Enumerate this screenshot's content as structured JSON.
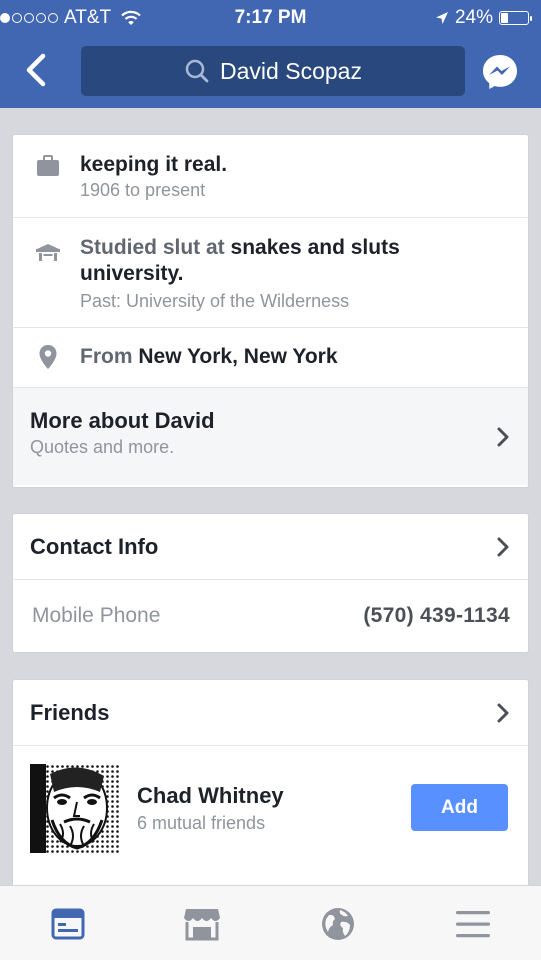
{
  "status_bar": {
    "carrier": "AT&T",
    "time": "7:17 PM",
    "battery": "24%",
    "signal_bars_filled": 1,
    "signal_bars_total": 5,
    "battery_level": 0.24
  },
  "header": {
    "search_text": "David Scopaz",
    "back_icon": "chevron-left-icon",
    "messenger_icon": "messenger-icon",
    "brand_color": "#4267b2"
  },
  "about": {
    "work": {
      "title": "keeping it real.",
      "subtitle": "1906 to present",
      "icon": "briefcase-icon"
    },
    "education": {
      "prefix": "Studied slut at ",
      "school": "snakes and sluts university.",
      "subtitle": "Past: University of the Wilderness",
      "icon": "school-icon"
    },
    "hometown": {
      "prefix": "From ",
      "place": "New York, New York",
      "icon": "location-pin-icon"
    },
    "more": {
      "title": "More about David",
      "subtitle": "Quotes and more."
    }
  },
  "contact_info": {
    "title": "Contact Info",
    "rows": [
      {
        "label": "Mobile Phone",
        "value": "(570) 439-1134"
      }
    ]
  },
  "friends": {
    "title": "Friends",
    "items": [
      {
        "name": "Chad Whitney",
        "mutual": "6 mutual friends",
        "action": "Add"
      }
    ]
  },
  "tab_bar": {
    "tabs": [
      {
        "icon": "news-feed-icon",
        "active": true
      },
      {
        "icon": "marketplace-icon",
        "active": false
      },
      {
        "icon": "globe-icon",
        "active": false
      },
      {
        "icon": "menu-icon",
        "active": false
      }
    ],
    "active_color": "#4267b2",
    "inactive_color": "#90949c"
  }
}
